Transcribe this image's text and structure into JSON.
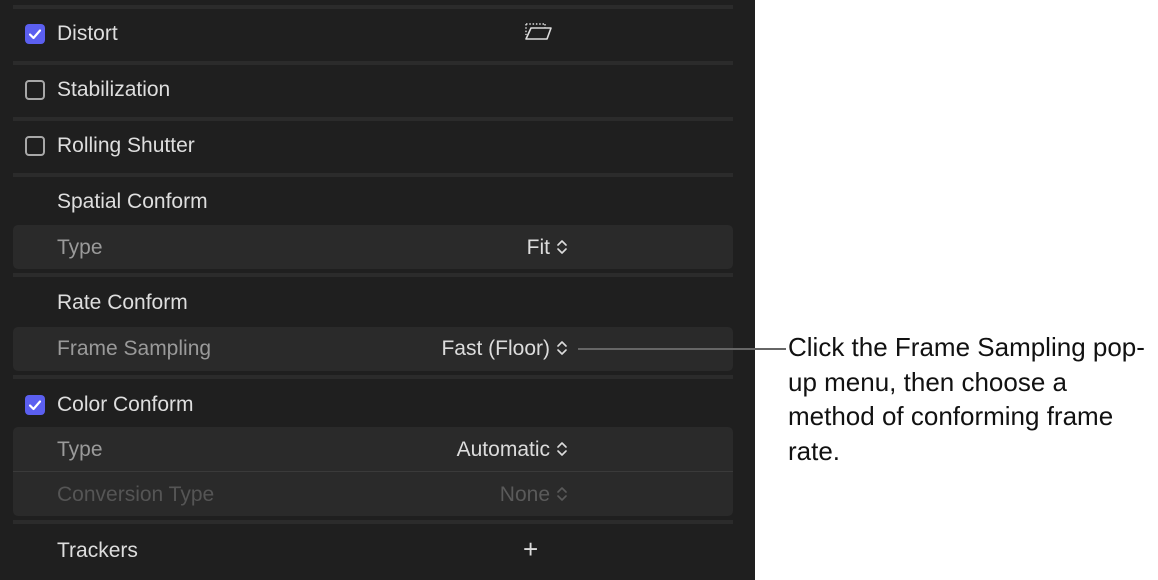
{
  "rows": {
    "distort": {
      "label": "Distort",
      "checked": true,
      "icon": "distort-icon"
    },
    "stabilization": {
      "label": "Stabilization",
      "checked": false
    },
    "rolling_shutter": {
      "label": "Rolling Shutter",
      "checked": false
    },
    "spatial_conform": {
      "label": "Spatial Conform",
      "type_label": "Type",
      "type_value": "Fit"
    },
    "rate_conform": {
      "label": "Rate Conform",
      "frame_sampling_label": "Frame Sampling",
      "frame_sampling_value": "Fast (Floor)"
    },
    "color_conform": {
      "label": "Color Conform",
      "checked": true,
      "type_label": "Type",
      "type_value": "Automatic",
      "conversion_label": "Conversion Type",
      "conversion_value": "None"
    },
    "trackers": {
      "label": "Trackers",
      "add_symbol": "+"
    }
  },
  "callout": {
    "text": "Click the Frame Sampling pop-up menu, then choose a method of conforming frame rate."
  },
  "colors": {
    "panel_bg": "#1f1f1f",
    "accent": "#5b5ff0"
  }
}
